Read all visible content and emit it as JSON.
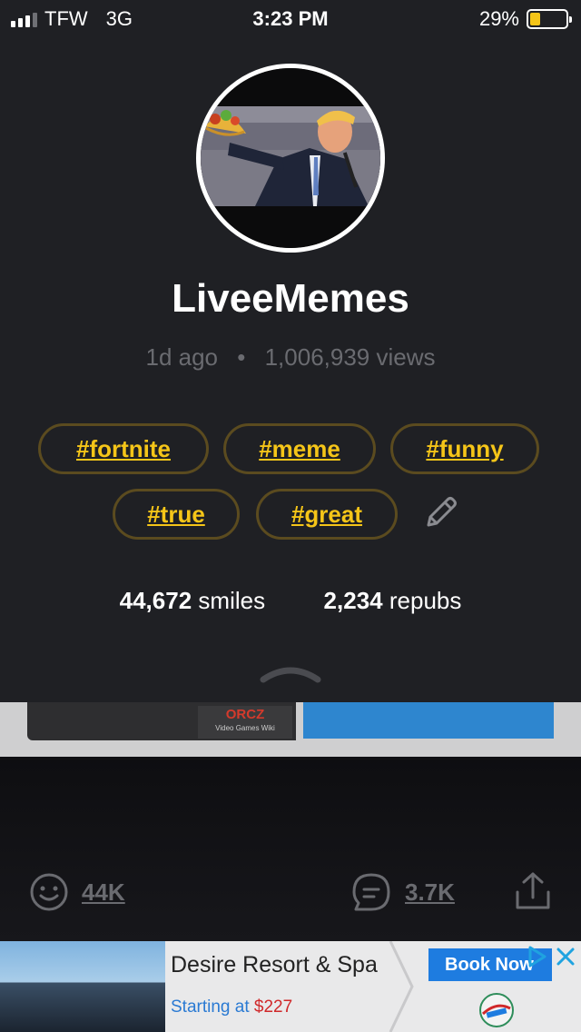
{
  "status_bar": {
    "carrier": "TFW",
    "network": "3G",
    "time": "3:23 PM",
    "battery_percent": "29%",
    "battery_level": 0.29,
    "signal_bars": 3
  },
  "profile": {
    "username": "LiveeMemes",
    "age": "1d ago",
    "separator": "•",
    "views": "1,006,939 views",
    "tags": [
      "#fortnite",
      "#meme",
      "#funny",
      "#true",
      "#great"
    ],
    "smiles_count": "44,672",
    "smiles_label": "smiles",
    "repubs_count": "2,234",
    "repubs_label": "repubs"
  },
  "meme_preview": {
    "logo_text": "ORCZ",
    "logo_sub": "Video Games Wiki"
  },
  "actions": {
    "smile_count": "44K",
    "comment_count": "3.7K"
  },
  "ad": {
    "title": "Desire Resort & Spa",
    "subtitle_prefix": "Starting at",
    "price": "$227",
    "button": "Book Now"
  },
  "colors": {
    "accent": "#f5c518",
    "panel": "#1f2024",
    "tag_border": "#5b4b1f",
    "muted": "#6a6b70",
    "ad_blue": "#1e7ce0"
  },
  "icons": [
    "signal-icon",
    "battery-icon",
    "pencil-icon",
    "chevron-up-icon",
    "smiley-icon",
    "comment-icon",
    "share-icon",
    "ad-choices-icon",
    "close-icon"
  ]
}
